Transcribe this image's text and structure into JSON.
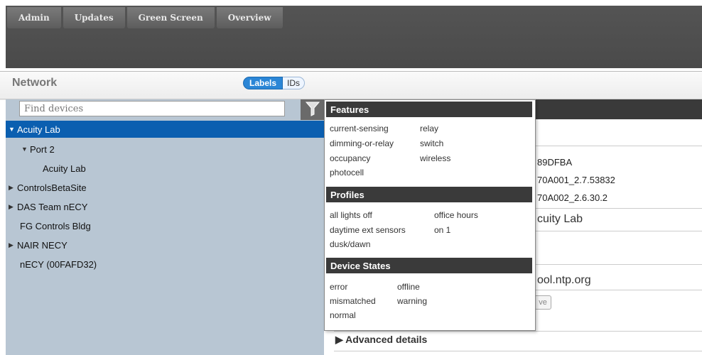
{
  "nav_tabs": [
    "Admin",
    "Updates",
    "Green Screen",
    "Overview"
  ],
  "network": {
    "title": "Network",
    "toggle": {
      "labels": "Labels",
      "ids": "IDs"
    },
    "search_placeholder": "Find devices"
  },
  "tree": [
    {
      "label": "Acuity Lab",
      "expanded": true,
      "selected": true
    },
    {
      "label": "Port 2",
      "expanded": true
    },
    {
      "label": "Acuity Lab"
    },
    {
      "label": "ControlsBetaSite",
      "expanded": false
    },
    {
      "label": "DAS Team nECY",
      "expanded": false
    },
    {
      "label": "FG Controls Bldg"
    },
    {
      "label": "NAIR NECY",
      "expanded": false
    },
    {
      "label": "nECY (00FAFD32)"
    }
  ],
  "filter_menu": {
    "features_title": "Features",
    "features": [
      "current-sensing",
      "relay",
      "dimming-or-relay",
      "switch",
      "occupancy",
      "wireless",
      "photocell"
    ],
    "profiles_title": "Profiles",
    "profiles": [
      "all lights off",
      "office hours",
      "daytime ext sensors",
      "on 1",
      "dusk/dawn"
    ],
    "states_title": "Device States",
    "states": [
      "error",
      "offline",
      "mismatched",
      "warning",
      "normal"
    ]
  },
  "detail": {
    "id_partial": "89DFBA",
    "fw1": "70A001_2.7.53832",
    "fw2": "70A002_2.6.30.2",
    "name_partial": "cuity Lab",
    "ntp_partial": "ool.ntp.org",
    "save_partial": "ve",
    "advanced": "Advanced details"
  },
  "colors": {
    "selected": "#0b5fb0",
    "tree_bg": "#b8c6d3",
    "header_dark": "#4a4a4a"
  }
}
